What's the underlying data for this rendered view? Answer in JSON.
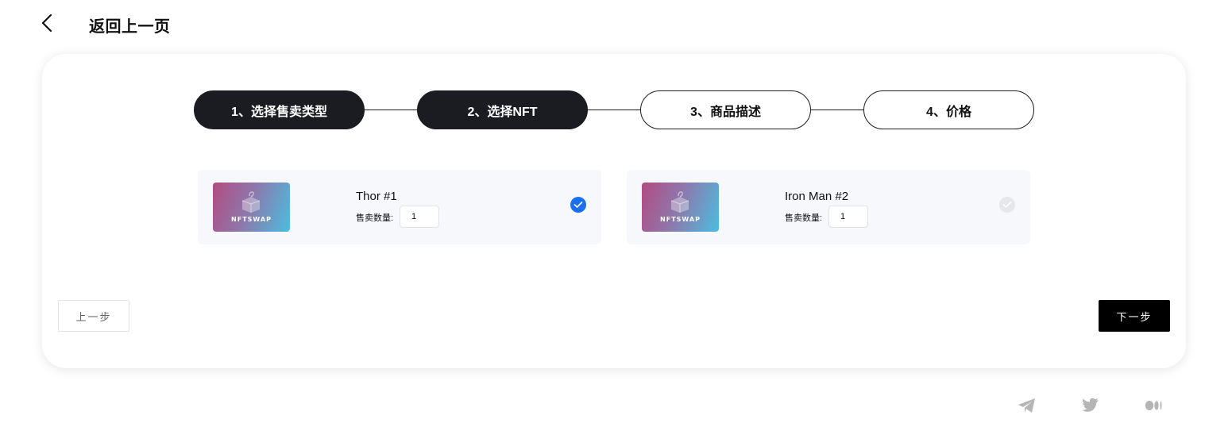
{
  "header": {
    "back_label": "返回上一页",
    "back_icon": "chevron-left-icon"
  },
  "steps": [
    {
      "label": "1、选择售卖类型",
      "state": "active"
    },
    {
      "label": "2、选择NFT",
      "state": "active"
    },
    {
      "label": "3、商品描述",
      "state": "inactive"
    },
    {
      "label": "4、价格",
      "state": "inactive"
    }
  ],
  "nfts": [
    {
      "name": "Thor #1",
      "qty_label": "售卖数量:",
      "qty_value": "1",
      "selected": true,
      "thumb_text": "NFTSWAP"
    },
    {
      "name": "Iron Man #2",
      "qty_label": "售卖数量:",
      "qty_value": "1",
      "selected": false,
      "thumb_text": "NFTSWAP"
    }
  ],
  "actions": {
    "prev_label": "上一步",
    "next_label": "下一步"
  },
  "footer": {
    "icons": [
      "telegram-icon",
      "twitter-icon",
      "medium-icon"
    ]
  },
  "colors": {
    "accent": "#1a6ff1",
    "dark": "#1a1c22",
    "card_bg": "#f7f8fc"
  }
}
